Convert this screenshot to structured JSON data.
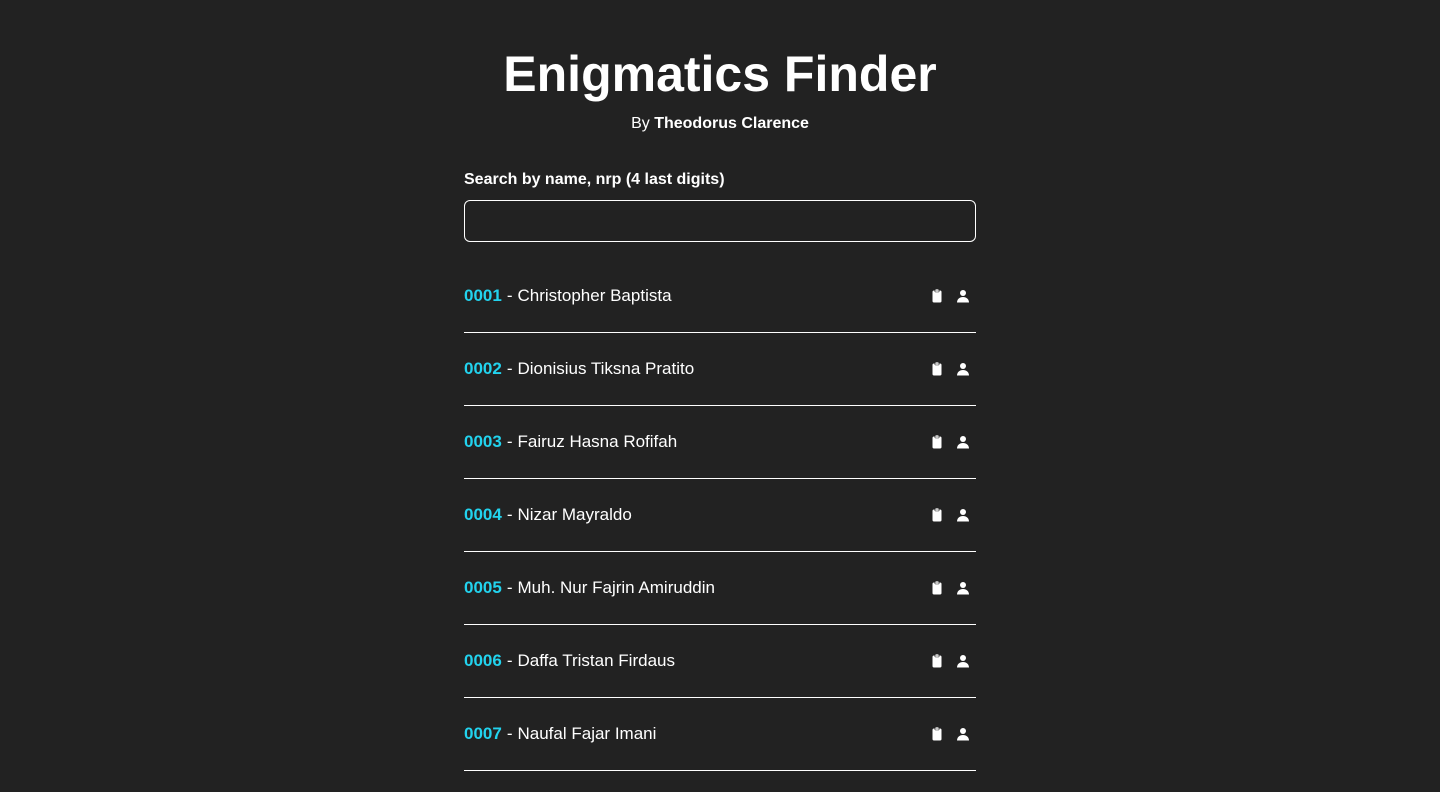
{
  "header": {
    "title": "Enigmatics Finder",
    "by_prefix": "By",
    "author": "Theodorus Clarence"
  },
  "search": {
    "label": "Search by name, nrp (4 last digits)",
    "value": "",
    "placeholder": ""
  },
  "colors": {
    "background": "#222222",
    "accent": "#22d3ee",
    "text": "#ffffff"
  },
  "icons": {
    "copy": "clipboard-icon",
    "profile": "user-icon"
  },
  "people": [
    {
      "nrp": "0001",
      "name": "Christopher Baptista"
    },
    {
      "nrp": "0002",
      "name": "Dionisius Tiksna Pratito"
    },
    {
      "nrp": "0003",
      "name": "Fairuz Hasna Rofifah"
    },
    {
      "nrp": "0004",
      "name": "Nizar Mayraldo"
    },
    {
      "nrp": "0005",
      "name": "Muh. Nur Fajrin Amiruddin"
    },
    {
      "nrp": "0006",
      "name": "Daffa Tristan Firdaus"
    },
    {
      "nrp": "0007",
      "name": "Naufal Fajar Imani"
    }
  ]
}
